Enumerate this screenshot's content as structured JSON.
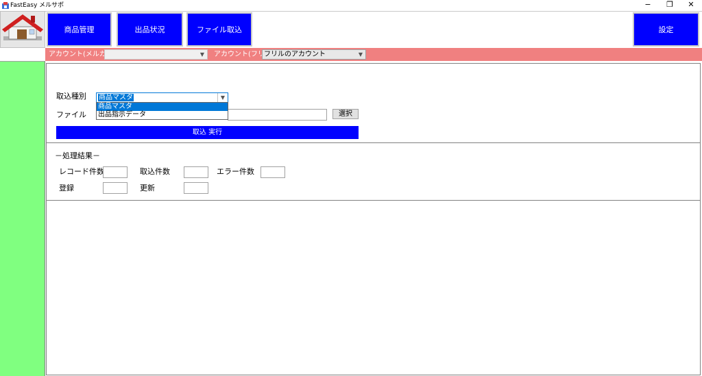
{
  "window": {
    "title": "FastEasy メルサポ",
    "minimize": "−",
    "restore": "❐",
    "close": "✕"
  },
  "toolbar": {
    "product_management": "商品管理",
    "listing_status": "出品状況",
    "file_import": "ファイル取込",
    "settings": "設定"
  },
  "accounts": {
    "mercari_label": "アカウント(メルカリ)",
    "mercari_value": "",
    "fril_label": "アカウント(フリル)",
    "fril_value": "フリルのアカウント"
  },
  "import_form": {
    "type_label": "取込種別",
    "type_value": "商品マスタ",
    "type_options": [
      "商品マスタ",
      "出品指示データ"
    ],
    "file_label": "ファイル",
    "file_value": "",
    "select_button": "選択",
    "execute_button": "取込  実行"
  },
  "results": {
    "heading": "－処理結果－",
    "record_count_label": "レコード件数",
    "import_count_label": "取込件数",
    "error_count_label": "エラー件数",
    "register_label": "登録",
    "update_label": "更新"
  },
  "colors": {
    "nav_button": "#0000ff",
    "account_bar": "#f08080",
    "left_strip": "#80ff80",
    "selection": "#0078d7"
  }
}
